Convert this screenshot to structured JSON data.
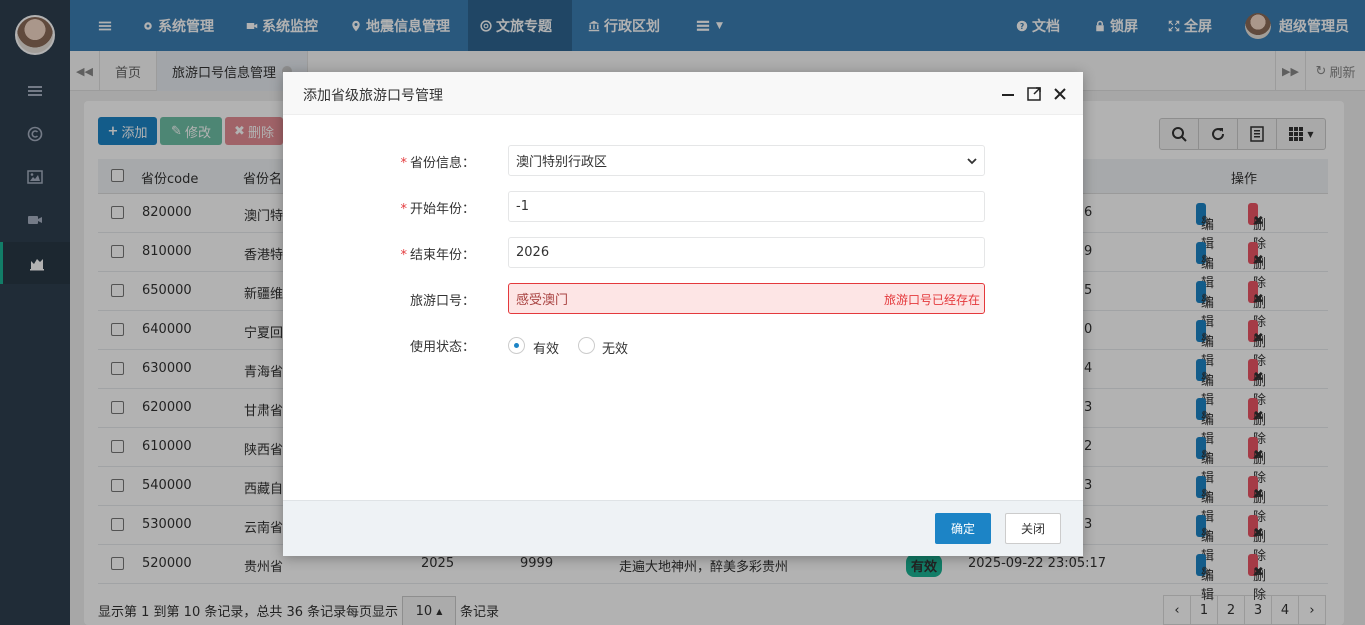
{
  "sidebar": {
    "icons": [
      "menu-icon",
      "copyright-icon",
      "image-icon",
      "video-icon",
      "chart-icon"
    ]
  },
  "topnav": {
    "items": [
      {
        "label": "系统管理",
        "icon": "gear-icon"
      },
      {
        "label": "系统监控",
        "icon": "video-icon"
      },
      {
        "label": "地震信息管理",
        "icon": "map-pin-icon"
      },
      {
        "label": "文旅专题",
        "icon": "lifebuoy-icon"
      },
      {
        "label": "行政区划",
        "icon": "bank-icon"
      }
    ],
    "docs": "文档",
    "lock": "锁屏",
    "fullscreen": "全屏",
    "user": "超级管理员"
  },
  "tabs": {
    "home": "首页",
    "current": "旅游口号信息管理",
    "refresh": "刷新"
  },
  "toolbar": {
    "add": "添加",
    "edit": "修改",
    "delete": "删除"
  },
  "table": {
    "headers": {
      "code": "省份code",
      "name": "省份名",
      "ops": "操作"
    },
    "rows": [
      {
        "code": "820000",
        "name": "澳门特",
        "tail": "6"
      },
      {
        "code": "810000",
        "name": "香港特",
        "tail": "9"
      },
      {
        "code": "650000",
        "name": "新疆维",
        "tail": "5"
      },
      {
        "code": "640000",
        "name": "宁夏回",
        "tail": "0"
      },
      {
        "code": "630000",
        "name": "青海省",
        "tail": "4"
      },
      {
        "code": "620000",
        "name": "甘肃省",
        "tail": "3"
      },
      {
        "code": "610000",
        "name": "陕西省",
        "tail": "2"
      },
      {
        "code": "540000",
        "name": "西藏自",
        "tail": "3"
      },
      {
        "code": "530000",
        "name": "云南省",
        "tail": "3"
      },
      {
        "code": "520000",
        "name": "贵州省",
        "start": "2025",
        "end": "9999",
        "slogan": "走遍大地神州，醉美多彩贵州",
        "status": "有效",
        "time": "2025-09-22 23:05:17"
      }
    ],
    "edit_label": "编辑",
    "delete_label": "删除"
  },
  "footer": {
    "summary": "显示第 1 到第 10 条记录，总共 36 条记录",
    "per_page_prefix": "每页显示",
    "per_page_value": "10",
    "per_page_suffix": "条记录",
    "pages": [
      "‹",
      "1",
      "2",
      "3",
      "4",
      "›"
    ]
  },
  "modal": {
    "title": "添加省级旅游口号管理",
    "fields": {
      "province_label": "省份信息：",
      "province_value": "澳门特别行政区",
      "start_label": "开始年份：",
      "start_value": "-1",
      "end_label": "结束年份：",
      "end_value": "2026",
      "slogan_label": "旅游口号：",
      "slogan_value": "感受澳门",
      "slogan_error": "旅游口号已经存在",
      "status_label": "使用状态：",
      "status_valid": "有效",
      "status_invalid": "无效"
    },
    "ok": "确定",
    "close": "关闭"
  }
}
